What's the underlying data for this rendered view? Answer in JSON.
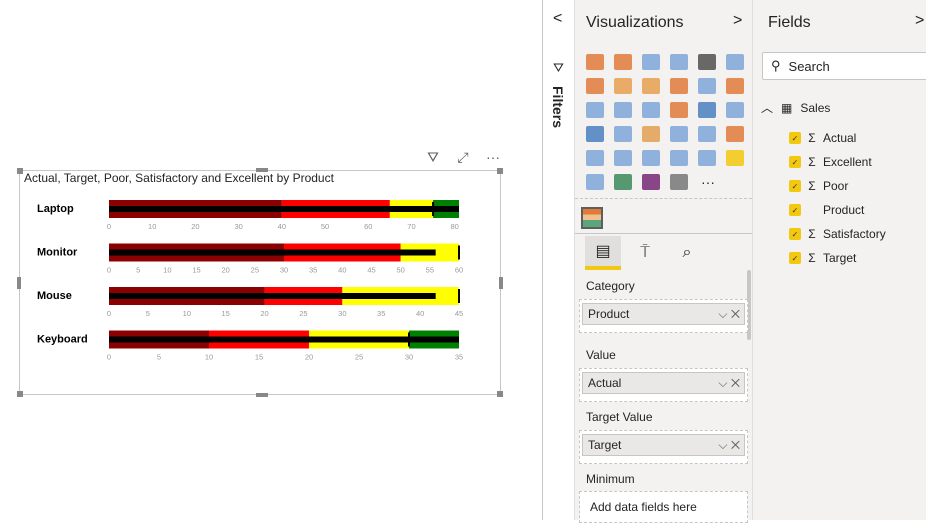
{
  "visual": {
    "header_icons": [
      "filter-icon",
      "focus-mode-icon",
      "more-options-icon"
    ]
  },
  "chart_data": {
    "type": "bullet",
    "title": "Actual, Target, Poor, Satisfactory and Excellent by Product",
    "range_colors": {
      "poor": "#8b0000",
      "satisfactory": "#ff0000",
      "good": "#ffff00",
      "excellent": "#008000",
      "actual": "#000000"
    },
    "rows": [
      {
        "category": "Laptop",
        "actual": 81,
        "target": 75,
        "poor": 40,
        "satisfactory": 65,
        "good": 75,
        "max": 81,
        "ticks": [
          0,
          10,
          20,
          30,
          40,
          50,
          60,
          70,
          80
        ]
      },
      {
        "category": "Monitor",
        "actual": 56,
        "target": 60,
        "poor": 30,
        "satisfactory": 50,
        "good": 60,
        "max": 60,
        "ticks": [
          0,
          5,
          10,
          15,
          20,
          25,
          30,
          35,
          40,
          45,
          50,
          55,
          60
        ]
      },
      {
        "category": "Mouse",
        "actual": 42,
        "target": 45,
        "poor": 20,
        "satisfactory": 30,
        "good": 45,
        "max": 45,
        "ticks": [
          0,
          5,
          10,
          15,
          20,
          25,
          30,
          35,
          40,
          45
        ]
      },
      {
        "category": "Keyboard",
        "actual": 35,
        "target": 30,
        "poor": 10,
        "satisfactory": 20,
        "good": 30,
        "max": 35,
        "ticks": [
          0,
          5,
          10,
          15,
          20,
          25,
          30,
          35
        ]
      }
    ]
  },
  "filters": {
    "label": "Filters",
    "collapse": "<"
  },
  "viz": {
    "title": "Visualizations",
    "expand": ">",
    "icon_colors": [
      "#e07a3a",
      "#e07a3a",
      "#7ea6d8",
      "#7ea6d8",
      "#505050",
      "#7ea6d8",
      "#e07a3a",
      "#e6a050",
      "#e6a050",
      "#e07a3a",
      "#7ea6d8",
      "#e07a3a",
      "#7ea6d8",
      "#7ea6d8",
      "#7ea6d8",
      "#e07a3a",
      "#4a7fc1",
      "#7ea6d8",
      "#4a7fc1",
      "#7ea6d8",
      "#e0a050",
      "#7ea6d8",
      "#7ea6d8",
      "#e07a3a",
      "#7ea6d8",
      "#7ea6d8",
      "#7ea6d8",
      "#7ea6d8",
      "#7ea6d8",
      "#f2c811",
      "#7ea6d8",
      "#3a8a5a",
      "#742774",
      "#777777"
    ],
    "more": "···",
    "tabs": [
      "fields-tab",
      "format-tab",
      "analytics-tab"
    ],
    "wells": [
      {
        "label": "Category",
        "value": "Product"
      },
      {
        "label": "Value",
        "value": "Actual"
      },
      {
        "label": "Target Value",
        "value": "Target"
      },
      {
        "label": "Minimum",
        "placeholder": "Add data fields here"
      }
    ]
  },
  "fields": {
    "title": "Fields",
    "expand": ">",
    "search_placeholder": "Search",
    "table": "Sales",
    "items": [
      {
        "name": "Actual",
        "sigma": "Σ"
      },
      {
        "name": "Excellent",
        "sigma": "Σ"
      },
      {
        "name": "Poor",
        "sigma": "Σ"
      },
      {
        "name": "Product",
        "sigma": ""
      },
      {
        "name": "Satisfactory",
        "sigma": "Σ"
      },
      {
        "name": "Target",
        "sigma": "Σ"
      }
    ]
  }
}
